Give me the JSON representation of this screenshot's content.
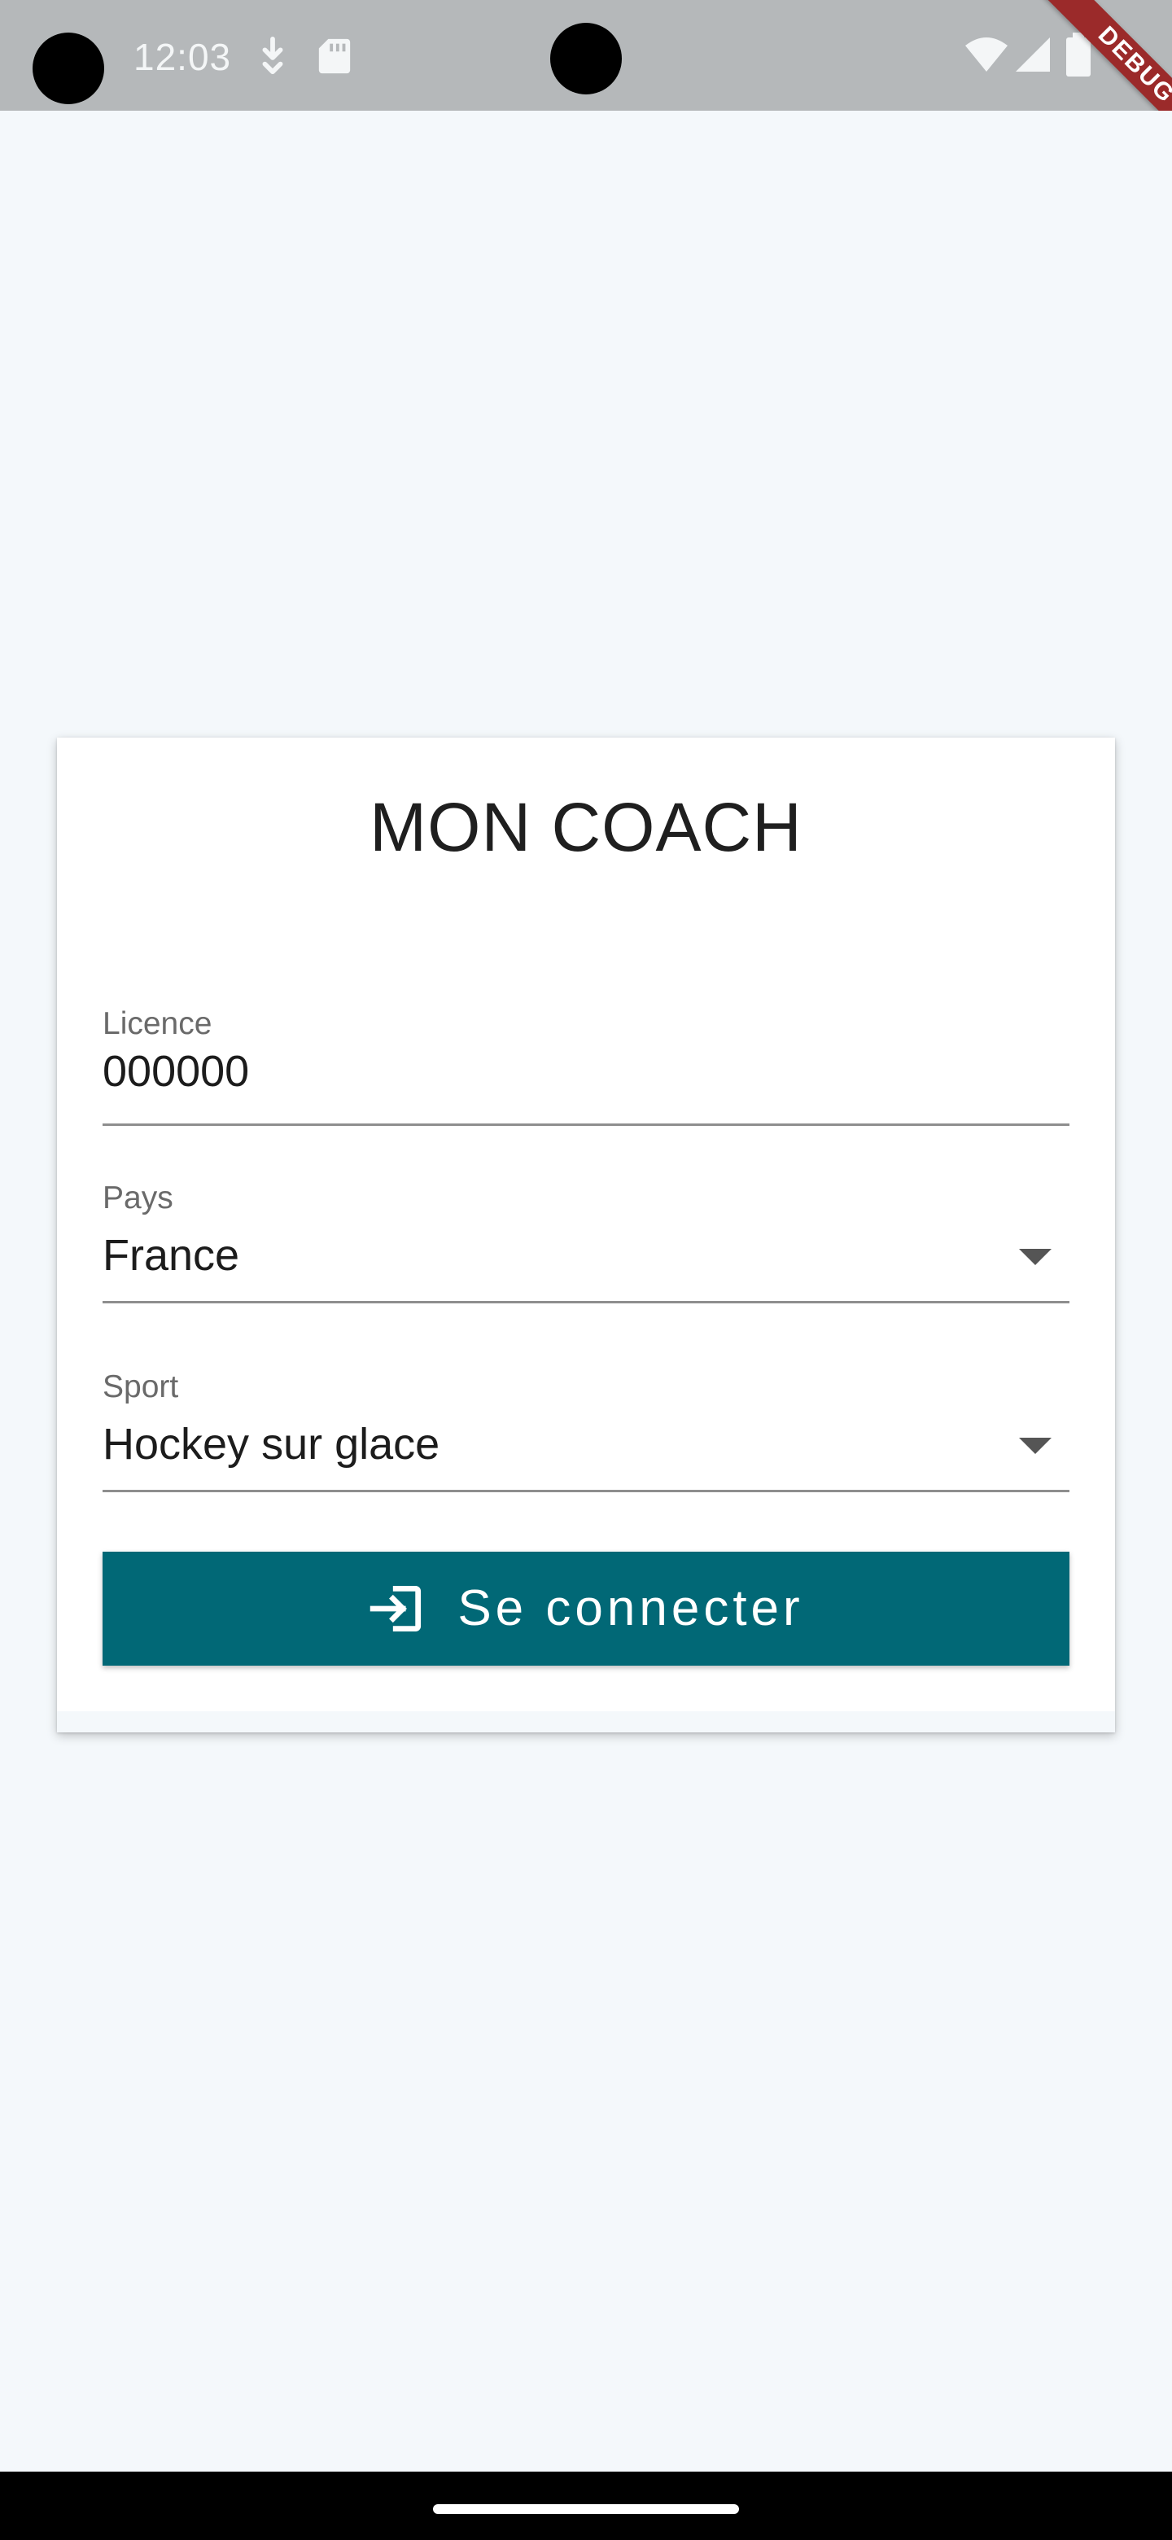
{
  "status_bar": {
    "time": "12:03",
    "debug_banner": "DEBUG"
  },
  "app": {
    "title": "MON COACH"
  },
  "form": {
    "licence": {
      "label": "Licence",
      "value": "000000"
    },
    "pays": {
      "label": "Pays",
      "value": "France"
    },
    "sport": {
      "label": "Sport",
      "value": "Hockey sur glace"
    },
    "submit_label": "Se connecter"
  },
  "colors": {
    "primary": "#016876",
    "background": "#f4f8fb",
    "status_bar": "#b5b8ba",
    "debug_ribbon": "#9b2a2a"
  },
  "icons": {
    "status": [
      "download-icon",
      "sd-card-icon",
      "wifi-icon",
      "cell-signal-icon",
      "battery-icon"
    ],
    "button": "login-icon"
  }
}
